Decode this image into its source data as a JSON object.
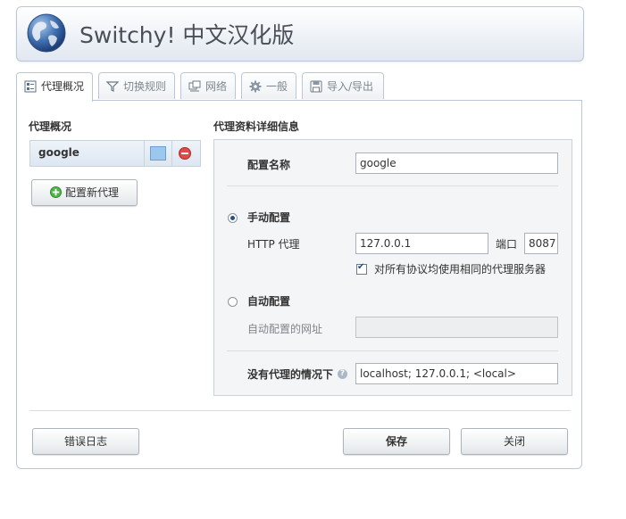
{
  "header": {
    "title": "Switchy! 中文汉化版"
  },
  "tabs": [
    {
      "label": "代理概况",
      "icon": "proxy-list-icon"
    },
    {
      "label": "切换规则",
      "icon": "filter-icon"
    },
    {
      "label": "网络",
      "icon": "network-icon"
    },
    {
      "label": "一般",
      "icon": "gear-icon"
    },
    {
      "label": "导入/导出",
      "icon": "floppy-disk-icon"
    }
  ],
  "left": {
    "section_title": "代理概况",
    "proxies": [
      {
        "name": "google",
        "color": "#9cc7ee"
      }
    ],
    "new_proxy_button": "配置新代理"
  },
  "detail": {
    "section_title": "代理资料详细信息",
    "profile_name_label": "配置名称",
    "profile_name_value": "google",
    "manual_label": "手动配置",
    "http_proxy_label": "HTTP 代理",
    "http_proxy_value": "127.0.0.1",
    "port_label": "端口",
    "port_value": "8087",
    "same_proxy_label": "对所有协议均使用相同的代理服务器",
    "auto_label": "自动配置",
    "auto_url_label": "自动配置的网址",
    "auto_url_value": "",
    "bypass_label": "没有代理的情况下",
    "bypass_value": "localhost; 127.0.0.1; <local>"
  },
  "footer": {
    "error_log_button": "错误日志",
    "save_button": "保存",
    "close_button": "关闭"
  }
}
